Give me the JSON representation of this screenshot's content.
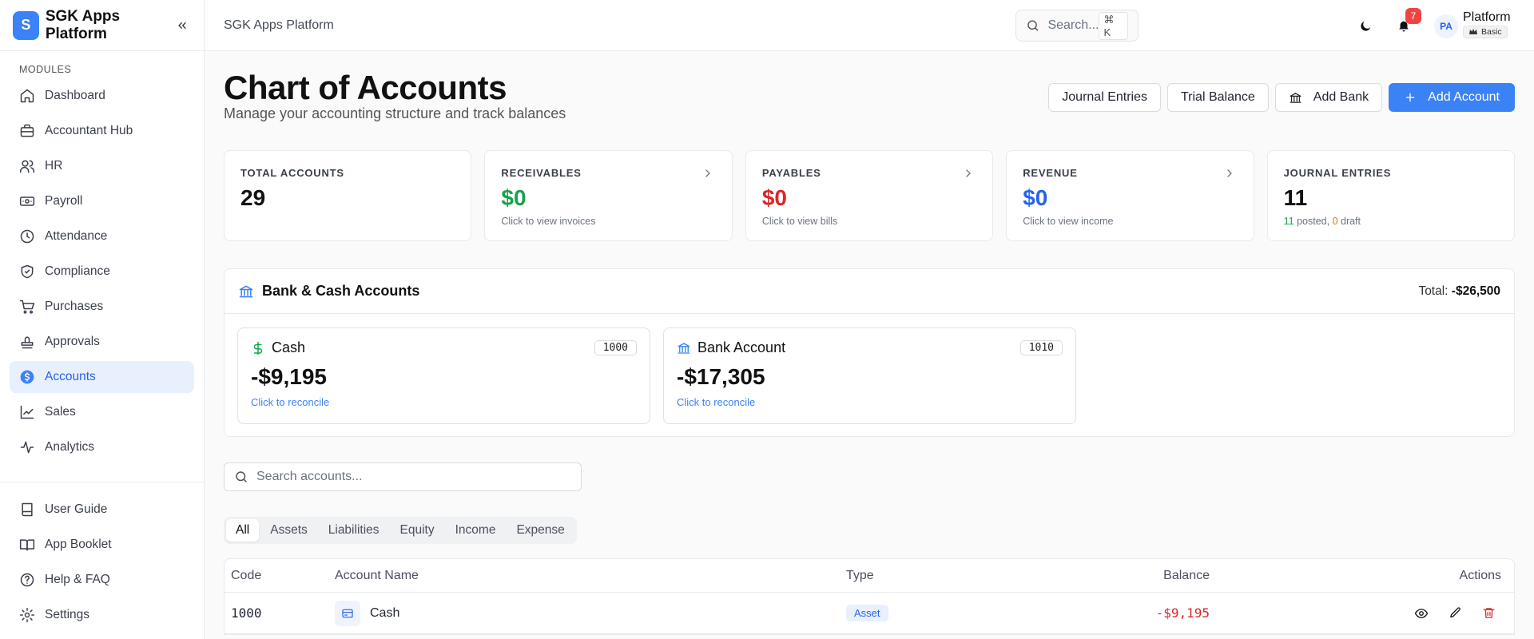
{
  "app": {
    "logo_letter": "S",
    "name": "SGK Apps Platform"
  },
  "sidebar": {
    "section_label": "MODULES",
    "items": [
      {
        "label": "Dashboard"
      },
      {
        "label": "Accountant Hub"
      },
      {
        "label": "HR"
      },
      {
        "label": "Payroll"
      },
      {
        "label": "Attendance"
      },
      {
        "label": "Compliance"
      },
      {
        "label": "Purchases"
      },
      {
        "label": "Approvals"
      },
      {
        "label": "Accounts",
        "active": true
      },
      {
        "label": "Sales"
      },
      {
        "label": "Analytics"
      }
    ],
    "footer_items": [
      {
        "label": "User Guide"
      },
      {
        "label": "App Booklet"
      },
      {
        "label": "Help & FAQ"
      },
      {
        "label": "Settings"
      }
    ]
  },
  "topbar": {
    "title": "SGK Apps Platform",
    "search_placeholder": "Search...",
    "search_shortcut": "⌘ K",
    "notification_count": "7",
    "user_initials": "PA",
    "user_name": "Platform",
    "plan": "Basic"
  },
  "page": {
    "title": "Chart of Accounts",
    "subtitle": "Manage your accounting structure and track balances",
    "actions": {
      "journal_entries": "Journal Entries",
      "trial_balance": "Trial Balance",
      "add_bank": "Add Bank",
      "add_account": "Add Account"
    }
  },
  "stats": {
    "total_accounts": {
      "label": "TOTAL ACCOUNTS",
      "value": "29"
    },
    "receivables": {
      "label": "RECEIVABLES",
      "value": "$0",
      "sub": "Click to view invoices",
      "color": "#16a34a"
    },
    "payables": {
      "label": "PAYABLES",
      "value": "$0",
      "sub": "Click to view bills",
      "color": "#dc2626"
    },
    "revenue": {
      "label": "REVENUE",
      "value": "$0",
      "sub": "Click to view income",
      "color": "#2563eb"
    },
    "journal_entries": {
      "label": "JOURNAL ENTRIES",
      "value": "11",
      "posted_count": "11",
      "posted_text": " posted, ",
      "draft_count": "0",
      "draft_text": " draft"
    }
  },
  "bank_section": {
    "title": "Bank & Cash Accounts",
    "total_label": "Total: ",
    "total_value": "-$26,500",
    "cards": [
      {
        "name": "Cash",
        "code": "1000",
        "amount": "-$9,195",
        "link": "Click to reconcile"
      },
      {
        "name": "Bank Account",
        "code": "1010",
        "amount": "-$17,305",
        "link": "Click to reconcile"
      }
    ]
  },
  "accounts_search": {
    "placeholder": "Search accounts..."
  },
  "tabs": [
    {
      "label": "All",
      "active": true
    },
    {
      "label": "Assets"
    },
    {
      "label": "Liabilities"
    },
    {
      "label": "Equity"
    },
    {
      "label": "Income"
    },
    {
      "label": "Expense"
    }
  ],
  "table": {
    "headers": {
      "code": "Code",
      "name": "Account Name",
      "type": "Type",
      "balance": "Balance",
      "actions": "Actions"
    },
    "rows": [
      {
        "code": "1000",
        "name": "Cash",
        "type": "Asset",
        "balance": "-$9,195"
      }
    ]
  }
}
